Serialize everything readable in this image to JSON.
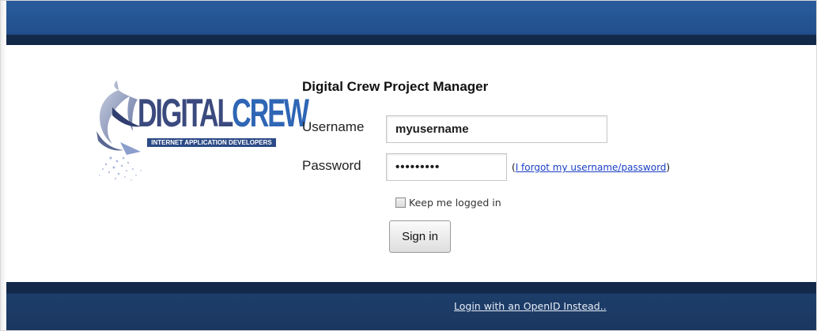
{
  "app": {
    "title": "Digital Crew Project Manager"
  },
  "logo": {
    "word_dark": "DIGITAL",
    "word_light": "CREW",
    "tagline": "INTERNET APPLICATION DEVELOPERS",
    "colors": {
      "dark": "#3b4a7e",
      "light": "#2f66b5",
      "tagline_bg": "#2b4a86"
    }
  },
  "form": {
    "username_label": "Username",
    "username_value": "myusername",
    "password_label": "Password",
    "password_value": "•••••••••",
    "forgot_open": "(",
    "forgot_link": "I forgot my username/password",
    "forgot_close": ")",
    "remember_label": "Keep me logged in",
    "remember_checked": false,
    "signin_label": "Sign in"
  },
  "footer": {
    "openid_link": "Login with an OpenID Instead.."
  },
  "colors": {
    "header_blue": "#22508c",
    "header_dark": "#13294a",
    "footer_blue": "#1a3760",
    "link": "#1a3fc4"
  }
}
